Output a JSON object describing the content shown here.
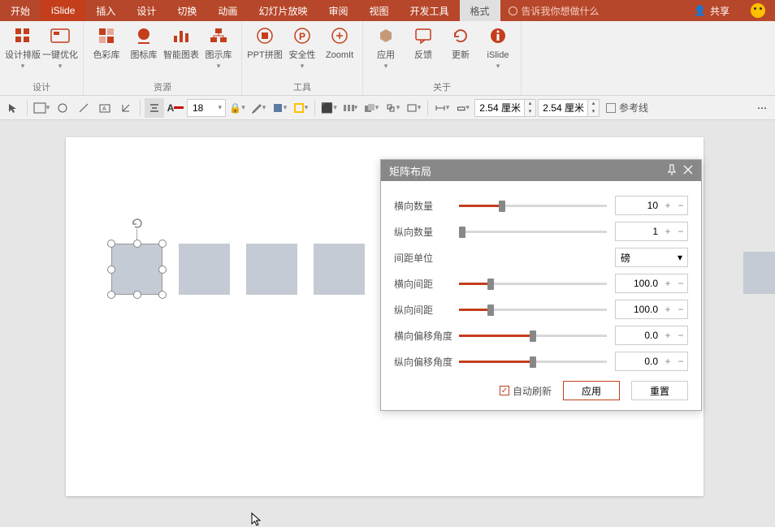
{
  "tabs": {
    "start": "开始",
    "islide": "iSlide",
    "insert": "插入",
    "design": "设计",
    "transition": "切换",
    "anim": "动画",
    "slideshow": "幻灯片放映",
    "review": "审阅",
    "view": "视图",
    "dev": "开发工具",
    "format": "格式"
  },
  "tellme": "告诉我你想做什么",
  "share": "共享",
  "ribbon": {
    "design": {
      "layout": "设计排版",
      "opt": "一键优化",
      "name": "设计"
    },
    "resource": {
      "color": "色彩库",
      "icon": "图标库",
      "chart": "智能图表",
      "diagram": "图示库",
      "name": "资源"
    },
    "tool": {
      "ppt": "PPT拼图",
      "safe": "安全性",
      "zoom": "ZoomIt",
      "name": "工具"
    },
    "about": {
      "app": "应用",
      "fb": "反馈",
      "upd": "更新",
      "islide": "iSlide",
      "name": "关于"
    }
  },
  "toolbar": {
    "fontsize": "18",
    "dim1": "2.54 厘米",
    "dim2": "2.54 厘米",
    "guides": "参考线"
  },
  "panel": {
    "title": "矩阵布局",
    "rows": {
      "hcount": {
        "label": "横向数量",
        "value": "10",
        "pct": 27
      },
      "vcount": {
        "label": "纵向数量",
        "value": "1",
        "pct": 0
      },
      "unit": {
        "label": "间距单位",
        "value": "磅"
      },
      "hgap": {
        "label": "横向间距",
        "value": "100.0",
        "pct": 19
      },
      "vgap": {
        "label": "纵向间距",
        "value": "100.0",
        "pct": 19
      },
      "hang": {
        "label": "横向偏移角度",
        "value": "0.0",
        "pct": 48
      },
      "vang": {
        "label": "纵向偏移角度",
        "value": "0.0",
        "pct": 48
      }
    },
    "auto": "自动刷新",
    "apply": "应用",
    "reset": "重置"
  }
}
